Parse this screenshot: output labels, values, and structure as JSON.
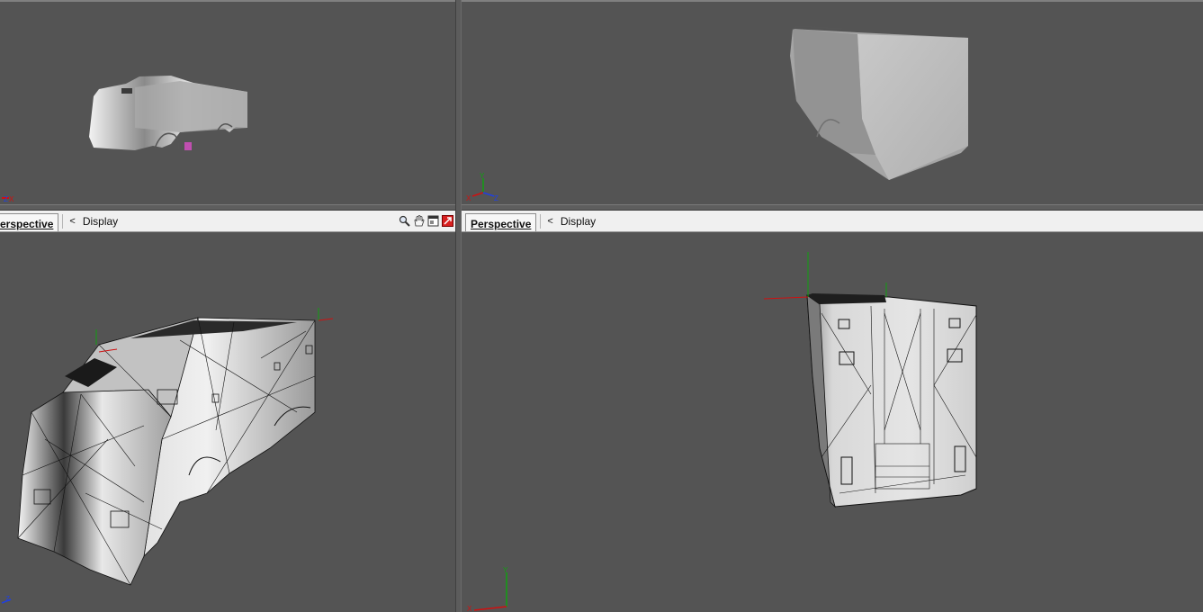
{
  "viewports": {
    "bottom_left": {
      "tab_label": "erspective",
      "display_label": "Display",
      "chevron": "<"
    },
    "bottom_right": {
      "tab_label": "Perspective",
      "display_label": "Display",
      "chevron": "<"
    }
  },
  "toolbar_icons": [
    "zoom-icon",
    "pan-hand-icon",
    "maximize-icon",
    "render-icon"
  ],
  "axes": {
    "x": "X",
    "y": "Y",
    "z": "Z"
  },
  "colors": {
    "viewport_bg": "#545454",
    "header_bg": "#f0f0f0",
    "axis_x": "#d01010",
    "axis_y": "#10a010",
    "axis_z": "#2040e0"
  }
}
